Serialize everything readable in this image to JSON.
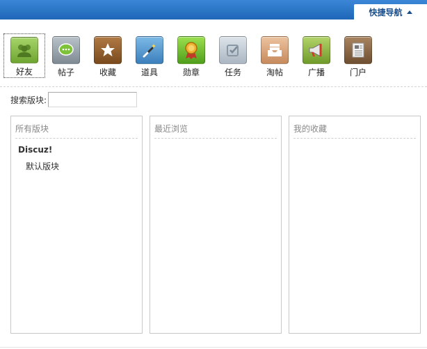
{
  "header": {
    "quick_nav_label": "快捷导航",
    "quick_nav_icon": "caret-up-icon",
    "bar_color": "#2c78cc"
  },
  "toolbar": {
    "items": [
      {
        "label": "好友",
        "icon": "friends-icon",
        "color": "#7cb342",
        "active": true
      },
      {
        "label": "帖子",
        "icon": "speech-bubble-icon",
        "color": "#8e9aa3"
      },
      {
        "label": "收藏",
        "icon": "star-icon",
        "color": "#8b5a2b"
      },
      {
        "label": "道具",
        "icon": "magic-wand-icon",
        "color": "#4a90c8"
      },
      {
        "label": "勋章",
        "icon": "medal-icon",
        "color": "#6cbf2f"
      },
      {
        "label": "任务",
        "icon": "checkbox-icon",
        "color": "#b8c4d0"
      },
      {
        "label": "淘帖",
        "icon": "inbox-tray-icon",
        "color": "#d9a37a"
      },
      {
        "label": "广播",
        "icon": "megaphone-icon",
        "color": "#8ab33f"
      },
      {
        "label": "门户",
        "icon": "newspaper-icon",
        "color": "#8b6a4a"
      }
    ]
  },
  "search": {
    "label": "搜索版块:",
    "value": "",
    "placeholder": ""
  },
  "panels": {
    "all": {
      "title": "所有版块",
      "root": "Discuz!",
      "children": [
        "默认版块"
      ]
    },
    "recent": {
      "title": "最近浏览"
    },
    "favorites": {
      "title": "我的收藏"
    }
  }
}
